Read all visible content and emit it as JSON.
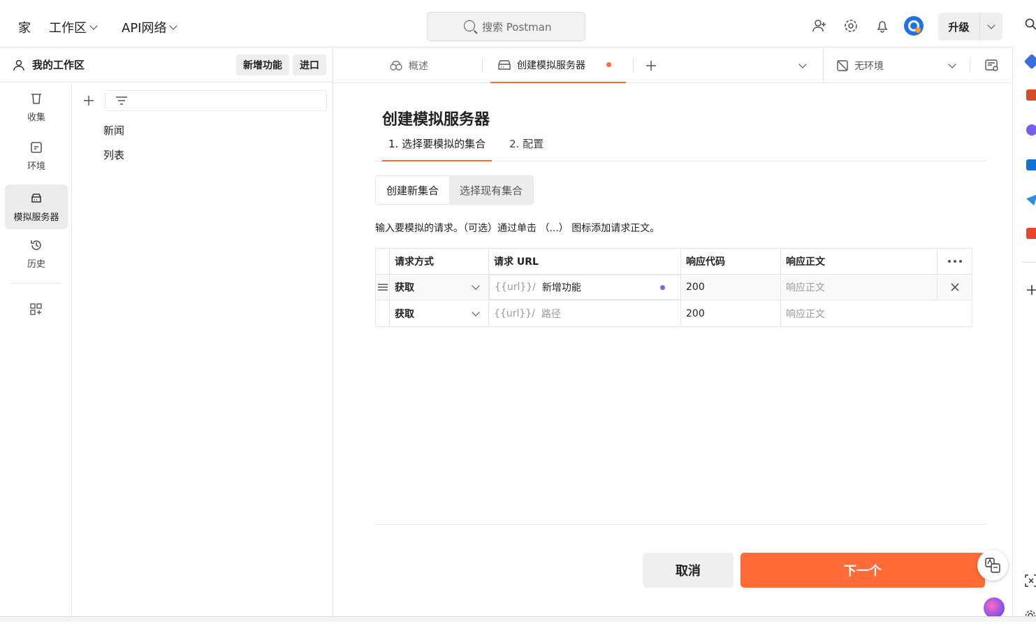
{
  "topbar": {
    "home": "家",
    "workspace": "工作区",
    "api_network": "API网络",
    "search_placeholder": "搜索 Postman",
    "upgrade": "升级"
  },
  "workspace": {
    "title": "我的工作区",
    "new_btn": "新增功能",
    "import_btn": "进口"
  },
  "rail": {
    "collections": "收集",
    "environments": "环境",
    "mock_servers": "模拟服务器",
    "history": "历史"
  },
  "tree": {
    "items": [
      "新闻",
      "列表"
    ]
  },
  "tabs": {
    "overview": "概述",
    "mock": "创建模拟服务器",
    "env": "无环境"
  },
  "page": {
    "title": "创建模拟服务器",
    "step1": "1. 选择要模拟的集合",
    "step2": "2. 配置",
    "seg_new": "创建新集合",
    "seg_existing": "选择现有集合",
    "hint": "输入要模拟的请求。（可选）通过单击 （...） 图标添加请求正文。"
  },
  "table": {
    "headers": {
      "method": "请求方式",
      "url": "请求 URL",
      "code": "响应代码",
      "body": "响应正文"
    },
    "rows": [
      {
        "method": "获取",
        "prefix": "{{url}}/",
        "url": "新增功能",
        "code": "200",
        "body": "响应正文"
      },
      {
        "method": "获取",
        "prefix": "{{url}}/",
        "url": "路径",
        "code": "200",
        "body": "响应正文"
      }
    ]
  },
  "footer": {
    "cancel": "取消",
    "next": "下一个"
  },
  "colors": {
    "accent": "#ff6c37",
    "purple": "#8e5ee8"
  }
}
